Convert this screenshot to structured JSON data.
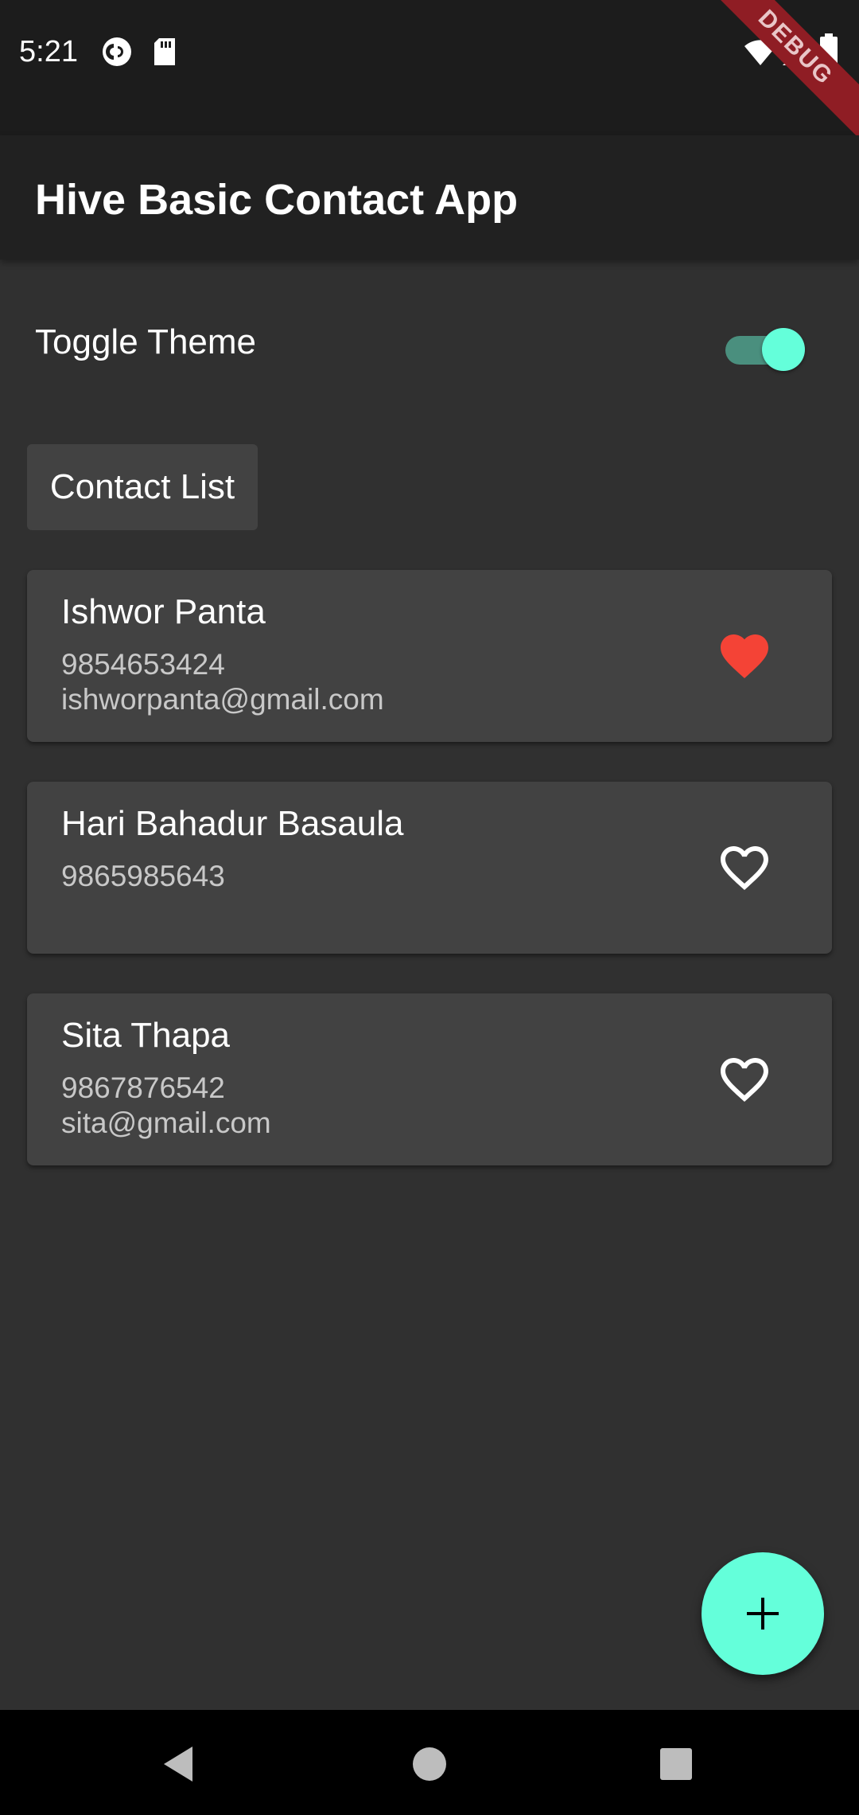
{
  "status_bar": {
    "time": "5:21",
    "icons_left": [
      "pocket-casts-icon",
      "sd-card-icon"
    ],
    "icons_right": [
      "wifi-icon",
      "signal-icon",
      "battery-icon"
    ],
    "debug_label": "DEBUG"
  },
  "app_bar": {
    "title": "Hive Basic Contact App"
  },
  "theme_toggle": {
    "label": "Toggle Theme",
    "on": true
  },
  "section": {
    "label": "Contact List"
  },
  "contacts": [
    {
      "name": "Ishwor Panta",
      "phone": "9854653424",
      "email": "ishworpanta@gmail.com",
      "favorite": true
    },
    {
      "name": "Hari Bahadur Basaula",
      "phone": "9865985643",
      "email": "",
      "favorite": false
    },
    {
      "name": "Sita Thapa",
      "phone": "9867876542",
      "email": "sita@gmail.com",
      "favorite": false
    }
  ],
  "fab": {
    "icon": "plus-icon"
  },
  "nav": {
    "icons": [
      "back-icon",
      "home-icon",
      "recents-icon"
    ]
  },
  "colors": {
    "accent": "#64ffda",
    "favorite": "#f44336",
    "background": "#303030",
    "card": "#424242",
    "app_bar": "#212121"
  }
}
